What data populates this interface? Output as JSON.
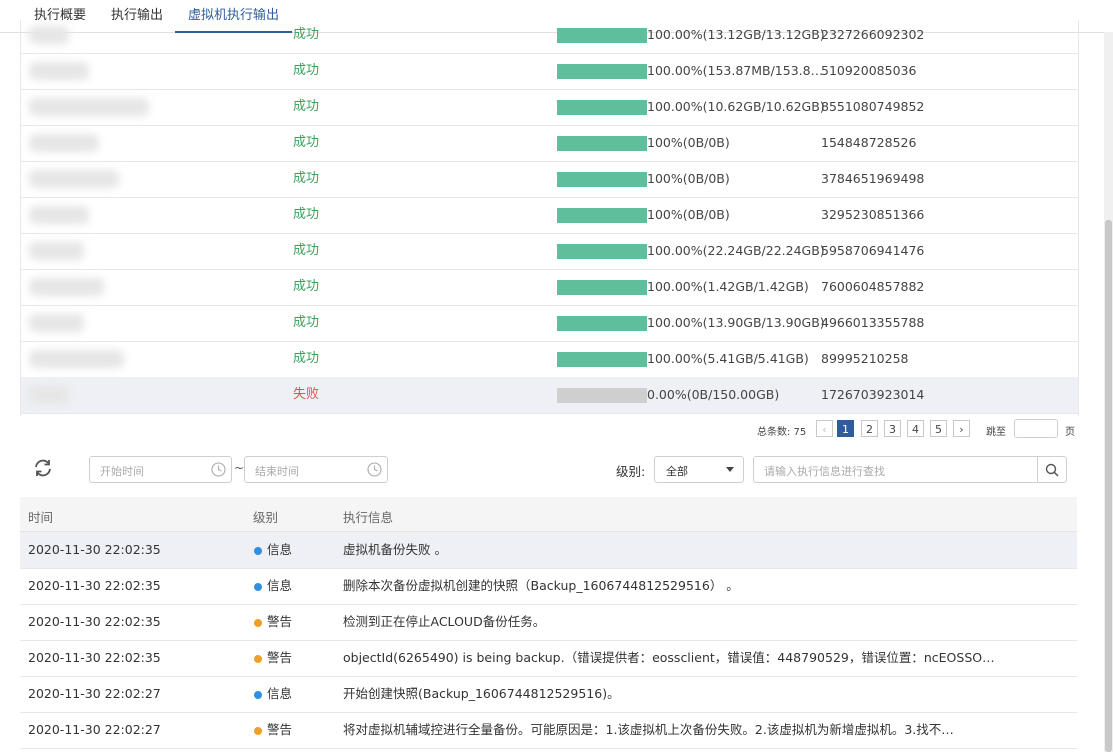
{
  "tabs": [
    {
      "label": "执行概要"
    },
    {
      "label": "执行输出"
    },
    {
      "label": "虚拟机执行输出"
    }
  ],
  "vm_rows": [
    {
      "status": "成功",
      "progress": 1.0,
      "pct_text": "100.00%(13.12GB/13.12GB)",
      "id": "2327266092302"
    },
    {
      "status": "成功",
      "progress": 1.0,
      "pct_text": "100.00%(153.87MB/153.8…",
      "id": "510920085036"
    },
    {
      "status": "成功",
      "progress": 1.0,
      "pct_text": "100.00%(10.62GB/10.62GB)",
      "id": "8551080749852"
    },
    {
      "status": "成功",
      "progress": 1.0,
      "pct_text": "100%(0B/0B)",
      "id": "154848728526"
    },
    {
      "status": "成功",
      "progress": 1.0,
      "pct_text": "100%(0B/0B)",
      "id": "3784651969498"
    },
    {
      "status": "成功",
      "progress": 1.0,
      "pct_text": "100%(0B/0B)",
      "id": "3295230851366"
    },
    {
      "status": "成功",
      "progress": 1.0,
      "pct_text": "100.00%(22.24GB/22.24GB)",
      "id": "5958706941476"
    },
    {
      "status": "成功",
      "progress": 1.0,
      "pct_text": "100.00%(1.42GB/1.42GB)",
      "id": "7600604857882"
    },
    {
      "status": "成功",
      "progress": 1.0,
      "pct_text": "100.00%(13.90GB/13.90GB)",
      "id": "4966013355788"
    },
    {
      "status": "成功",
      "progress": 1.0,
      "pct_text": "100.00%(5.41GB/5.41GB)",
      "id": "89995210258"
    },
    {
      "status": "失败",
      "progress": 0.0,
      "pct_text": "0.00%(0B/150.00GB)",
      "id": "1726703923014"
    }
  ],
  "pagination": {
    "total_label": "总条数: 75",
    "prev": "‹",
    "pages": [
      "1",
      "2",
      "3",
      "4",
      "5"
    ],
    "active_page": "1",
    "next": "›",
    "jump_label": "跳至",
    "page_suffix": "页"
  },
  "filters": {
    "refresh_icon": "refresh-icon",
    "start_placeholder": "开始时间",
    "separator": "~",
    "end_placeholder": "结束时间",
    "level_label": "级别:",
    "level_value": "全部",
    "search_placeholder": "请输入执行信息进行查找"
  },
  "log_headers": {
    "time": "时间",
    "level": "级别",
    "message": "执行信息"
  },
  "logs": [
    {
      "time": "2020-11-30 22:02:35",
      "level": "信息",
      "color": "#2f8fe0",
      "message": "虚拟机备份失败 。"
    },
    {
      "time": "2020-11-30 22:02:35",
      "level": "信息",
      "color": "#2f8fe0",
      "message": "删除本次备份虚拟机创建的快照（Backup_1606744812529516） 。"
    },
    {
      "time": "2020-11-30 22:02:35",
      "level": "警告",
      "color": "#f0a020",
      "message": "检测到正在停止ACLOUD备份任务。"
    },
    {
      "time": "2020-11-30 22:02:35",
      "level": "警告",
      "color": "#f0a020",
      "message": "objectId(6265490) is being backup.（错误提供者：eossclient，错误值：448790529，错误位置：ncEOSSO…"
    },
    {
      "time": "2020-11-30 22:02:27",
      "level": "信息",
      "color": "#2f8fe0",
      "message": "开始创建快照(Backup_1606744812529516)。"
    },
    {
      "time": "2020-11-30 22:02:27",
      "level": "警告",
      "color": "#f0a020",
      "message": "将对虚拟机辅域控进行全量备份。可能原因是：1.该虚拟机上次备份失败。2.该虚拟机为新增虚拟机。3.找不…"
    }
  ],
  "colors": {
    "accent": "#2f5d9c",
    "success": "#3aa35a",
    "fail": "#e0554a",
    "bar_fill": "#5fbf9c",
    "bar_empty": "#cfcfcf"
  }
}
